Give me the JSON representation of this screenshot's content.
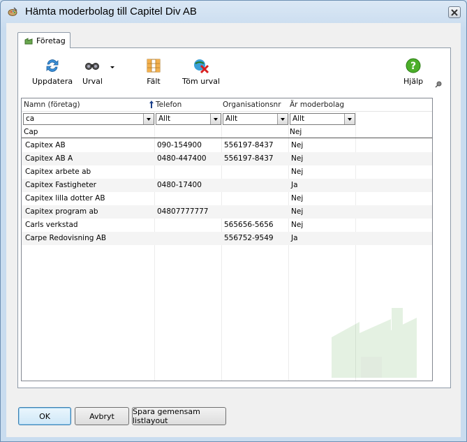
{
  "window": {
    "title": "Hämta moderbolag till Capitel Div AB"
  },
  "tab": {
    "label": "Företag"
  },
  "toolbar": {
    "refresh_label": "Uppdatera",
    "filter_label": "Urval",
    "fields_label": "Fält",
    "clear_label": "Töm urval",
    "help_label": "Hjälp"
  },
  "grid": {
    "headers": [
      "Namn (företag)",
      "Telefon",
      "Organisationsnr",
      "Är moderbolag"
    ],
    "filters": [
      "ca",
      "Allt",
      "Allt",
      "Allt"
    ],
    "new_row": {
      "name": "Cap",
      "parent": "Nej"
    },
    "rows": [
      {
        "name": "Capitex AB",
        "phone": "090-154900",
        "org": "556197-8437",
        "parent": "Nej"
      },
      {
        "name": "Capitex AB A",
        "phone": "0480-447400",
        "org": "556197-8437",
        "parent": "Nej"
      },
      {
        "name": "Capitex arbete ab",
        "phone": "",
        "org": "",
        "parent": "Nej"
      },
      {
        "name": "Capitex Fastigheter",
        "phone": "0480-17400",
        "org": "",
        "parent": "Ja"
      },
      {
        "name": "Capitex lilla dotter AB",
        "phone": "",
        "org": "",
        "parent": "Nej"
      },
      {
        "name": "Capitex program ab",
        "phone": "04807777777",
        "org": "",
        "parent": "Nej"
      },
      {
        "name": "Carls verkstad",
        "phone": "",
        "org": "565656-5656",
        "parent": "Nej"
      },
      {
        "name": "Carpe Redovisning AB",
        "phone": "",
        "org": "556752-9549",
        "parent": "Ja"
      }
    ]
  },
  "footer": {
    "ok_label": "OK",
    "cancel_label": "Avbryt",
    "save_layout_label": "Spara gemensam listlayout"
  }
}
